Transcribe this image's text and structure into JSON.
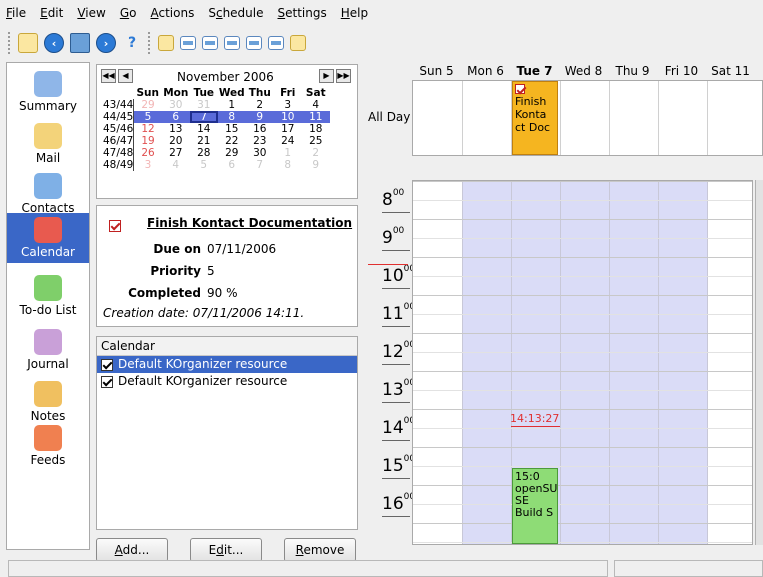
{
  "menu": [
    {
      "label": "File",
      "ul": "F",
      "rest": "ile"
    },
    {
      "label": "Edit",
      "ul": "E",
      "rest": "dit"
    },
    {
      "label": "View",
      "ul": "V",
      "rest": "iew"
    },
    {
      "label": "Go",
      "ul": "G",
      "rest": "o"
    },
    {
      "label": "Actions",
      "ul": "A",
      "rest": "ctions"
    },
    {
      "label": "Schedule",
      "pre": "S",
      "ul": "c",
      "rest": "hedule"
    },
    {
      "label": "Settings",
      "ul": "S",
      "rest": "ettings"
    },
    {
      "label": "Help",
      "ul": "H",
      "rest": "elp"
    }
  ],
  "toolbar_icons": [
    "new-event-icon",
    "back-icon",
    "new-mail-icon",
    "forward-icon",
    "whats-this-icon",
    "todo-view-icon",
    "day-view-icon",
    "workweek-view-icon",
    "week-view-icon",
    "next-days-view-icon",
    "month-view-icon",
    "journal-view-icon"
  ],
  "sidebar": {
    "items": [
      {
        "label": "Summary",
        "icon": "summary-icon",
        "active": false
      },
      {
        "label": "Mail",
        "icon": "mail-icon",
        "active": false
      },
      {
        "label": "Contacts",
        "icon": "contacts-icon",
        "active": false
      },
      {
        "label": "Calendar",
        "icon": "calendar-icon",
        "active": true
      },
      {
        "label": "To-do List",
        "icon": "todo-icon",
        "active": false
      },
      {
        "label": "Journal",
        "icon": "journal-icon",
        "active": false
      },
      {
        "label": "Notes",
        "icon": "notes-icon",
        "active": false
      },
      {
        "label": "Feeds",
        "icon": "feeds-icon",
        "active": false
      }
    ]
  },
  "minical": {
    "month_label": "November 2006",
    "day_names": [
      "Sun",
      "Mon",
      "Tue",
      "Wed",
      "Thu",
      "Fri",
      "Sat"
    ],
    "weeks": [
      {
        "wk": "43/44",
        "days": [
          "29",
          "30",
          "31",
          "1",
          "2",
          "3",
          "4"
        ],
        "off": [
          0,
          1,
          2
        ],
        "sel": false
      },
      {
        "wk": "44/45",
        "days": [
          "5",
          "6",
          "7",
          "8",
          "9",
          "10",
          "11"
        ],
        "off": [],
        "sel": true
      },
      {
        "wk": "45/46",
        "days": [
          "12",
          "13",
          "14",
          "15",
          "16",
          "17",
          "18"
        ],
        "off": [],
        "sel": false
      },
      {
        "wk": "46/47",
        "days": [
          "19",
          "20",
          "21",
          "22",
          "23",
          "24",
          "25"
        ],
        "off": [],
        "sel": false
      },
      {
        "wk": "47/48",
        "days": [
          "26",
          "27",
          "28",
          "29",
          "30",
          "1",
          "2"
        ],
        "off": [
          5,
          6
        ],
        "sel": false
      },
      {
        "wk": "48/49",
        "days": [
          "3",
          "4",
          "5",
          "6",
          "7",
          "8",
          "9"
        ],
        "off": [
          0,
          1,
          2,
          3,
          4,
          5,
          6
        ],
        "sel": false
      }
    ],
    "today_index": [
      1,
      2
    ]
  },
  "details": {
    "title": "Finish Kontact Documentation",
    "due_label": "Due on",
    "due_value": "07/11/2006",
    "priority_label": "Priority",
    "priority_value": "5",
    "completed_label": "Completed",
    "completed_value": "90 %",
    "creation": "Creation date: 07/11/2006 14:11."
  },
  "resources": {
    "header": "Calendar",
    "rows": [
      {
        "label": "Default KOrganizer resource",
        "checked": true,
        "selected": true
      },
      {
        "label": "Default KOrganizer resource",
        "checked": true,
        "selected": false
      }
    ]
  },
  "buttons": {
    "add": {
      "pre": "",
      "ul": "A",
      "rest": "dd..."
    },
    "edit": {
      "pre": "E",
      "ul": "d",
      "rest": "it..."
    },
    "remove": {
      "pre": "",
      "ul": "R",
      "rest": "emove"
    }
  },
  "agenda": {
    "days": [
      "Sun 5",
      "Mon 6",
      "Tue 7",
      "Wed 8",
      "Thu 9",
      "Fri 10",
      "Sat 11"
    ],
    "today_index": 2,
    "all_day_label": "All Day",
    "all_day_event": {
      "lines": [
        "Finish",
        "Konta",
        "ct Doc"
      ],
      "color": "#f5b520"
    },
    "hours": [
      "8",
      "9",
      "10",
      "11",
      "12",
      "13",
      "14",
      "15",
      "16"
    ],
    "current_time": "14:13:27",
    "event": {
      "lines": [
        "15:0",
        "openSU",
        "SE",
        "Build S"
      ],
      "color": "#8edc76"
    }
  },
  "colors": {
    "work_hours": "#dadcf7",
    "selection": "#3a67c7",
    "now_line": "#e03030"
  }
}
